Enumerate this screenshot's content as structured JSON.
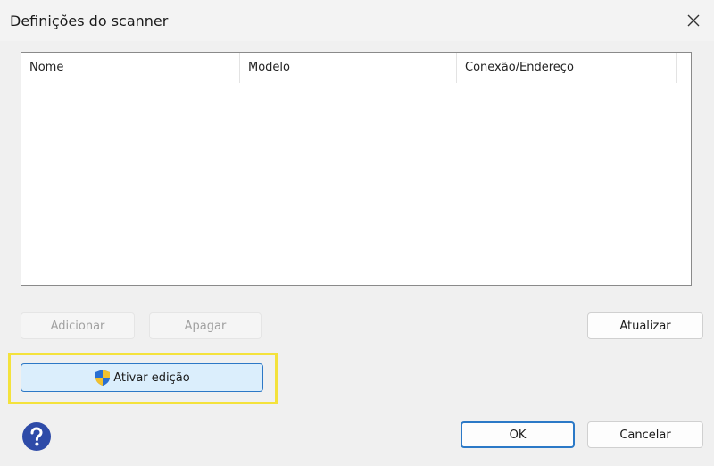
{
  "window": {
    "title": "Definições do scanner"
  },
  "list": {
    "columns": [
      "Nome",
      "Modelo",
      "Conexão/Endereço",
      ""
    ],
    "rows": []
  },
  "buttons": {
    "add": "Adicionar",
    "delete": "Apagar",
    "refresh": "Atualizar",
    "enable_edit": "Ativar edição",
    "ok": "OK",
    "cancel": "Cancelar"
  },
  "colors": {
    "highlight": "#f4e23c",
    "accent": "#2b79c7",
    "help_icon": "#2e4ba8"
  },
  "icons": {
    "close": "close-icon",
    "shield": "uac-shield-icon",
    "help": "help-icon"
  }
}
